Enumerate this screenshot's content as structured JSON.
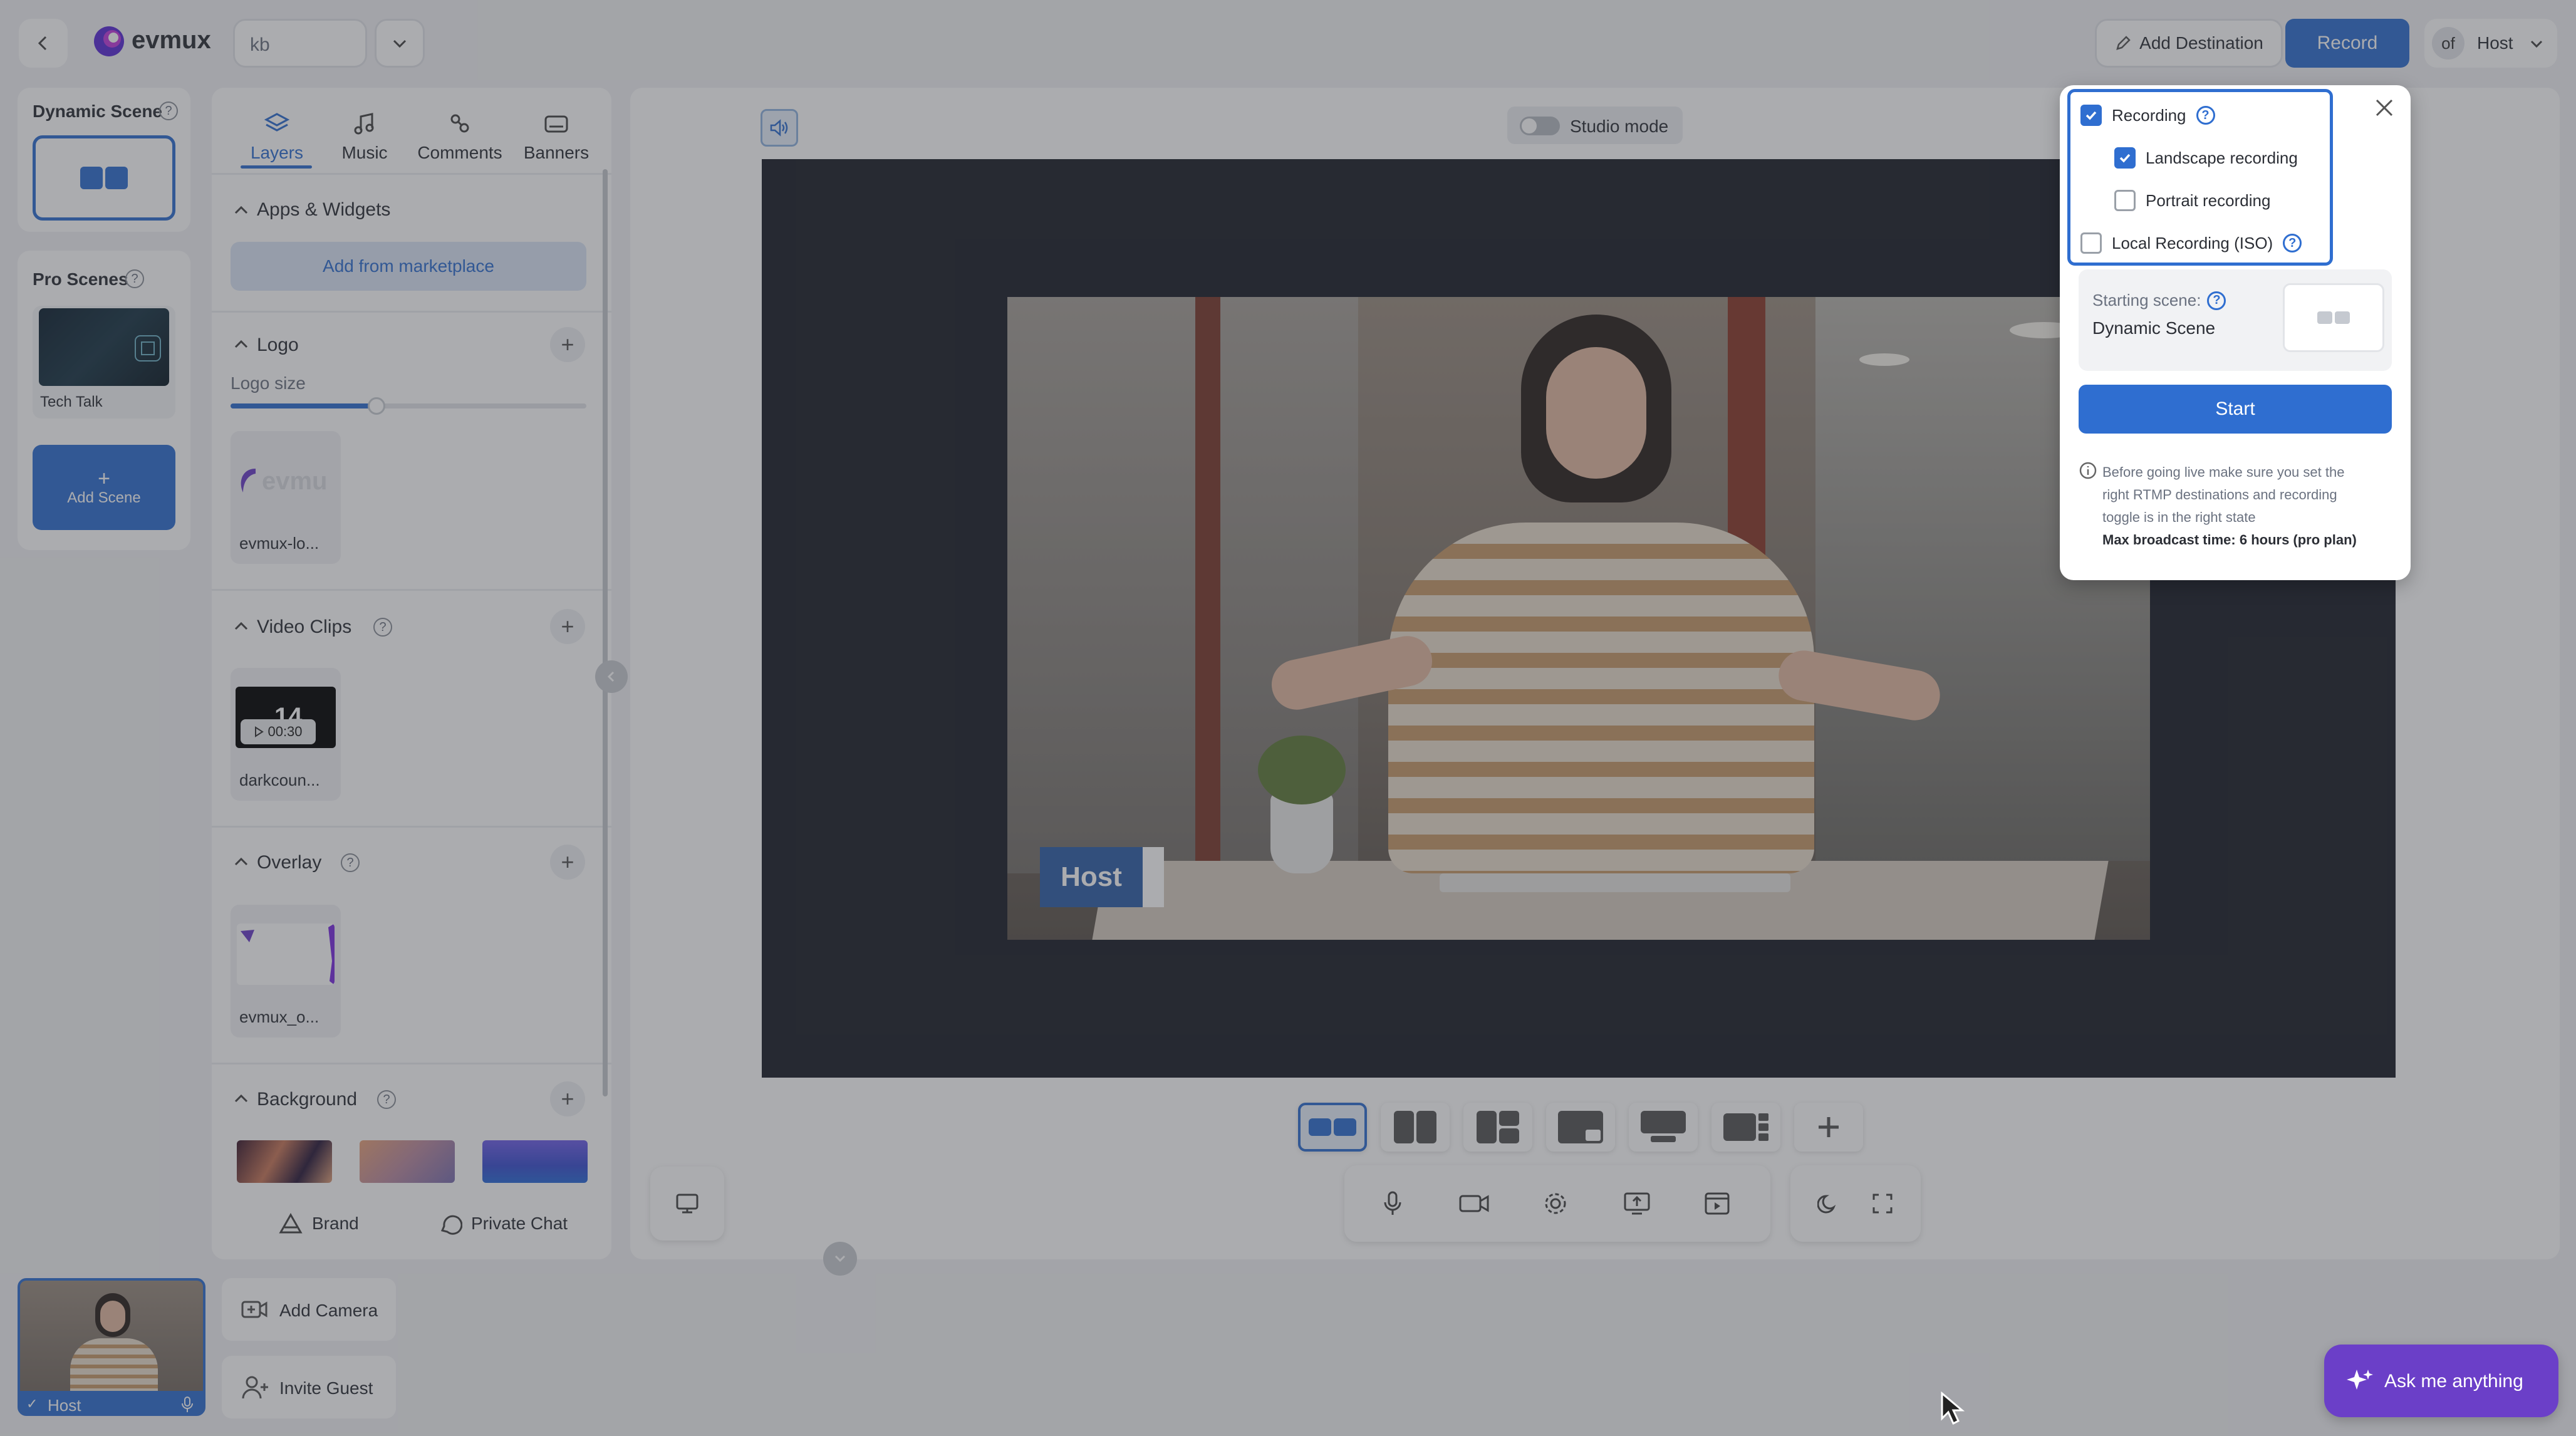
{
  "header": {
    "brand": "evmux",
    "studio_name": "kb",
    "add_destination_label": "Add Destination",
    "record_label": "Record",
    "user_initials": "of",
    "user_name": "Host"
  },
  "scenes": {
    "dynamic_title": "Dynamic Scene",
    "pro_title": "Pro Scenes",
    "pro_items": [
      {
        "label": "Tech Talk"
      }
    ],
    "add_scene_label": "Add Scene"
  },
  "layers_panel": {
    "tabs": [
      {
        "label": "Layers",
        "icon": "layers-icon"
      },
      {
        "label": "Music",
        "icon": "music-icon"
      },
      {
        "label": "Comments",
        "icon": "comments-icon"
      },
      {
        "label": "Banners",
        "icon": "banners-icon"
      }
    ],
    "apps_title": "Apps & Widgets",
    "add_marketplace_label": "Add from marketplace",
    "logo_title": "Logo",
    "logo_size_label": "Logo size",
    "logo_size_value": 0.41,
    "logo_item_label": "evmux-lo...",
    "logo_preview_text": "evmu",
    "video_clips_title": "Video Clips",
    "video_clip_label": "darkcoun...",
    "video_clip_duration": "00:30",
    "video_clip_overlay_text": "14",
    "overlay_title": "Overlay",
    "overlay_item_label": "evmux_o...",
    "background_title": "Background",
    "brand_label": "Brand",
    "private_chat_label": "Private Chat"
  },
  "stage": {
    "studio_mode_label": "Studio mode",
    "host_lower_third": "Host"
  },
  "bottom": {
    "participant_name": "Host",
    "add_camera_label": "Add Camera",
    "invite_guest_label": "Invite Guest",
    "ask_label": "Ask me anything"
  },
  "record_popup": {
    "recording_label": "Recording",
    "landscape_label": "Landscape recording",
    "portrait_label": "Portrait recording",
    "local_label": "Local Recording (ISO)",
    "recording_checked": true,
    "landscape_checked": true,
    "portrait_checked": false,
    "local_checked": false,
    "starting_scene_label": "Starting scene:",
    "starting_scene_value": "Dynamic Scene",
    "start_label": "Start",
    "info_line1": "Before going live make sure you set the",
    "info_line2": "right RTMP destinations and recording",
    "info_line3": "toggle is in the right state",
    "info_bold": "Max broadcast time: 6 hours (pro plan)"
  },
  "colors": {
    "accent": "#2f6ed0",
    "ask_purple": "#6b3fc8",
    "stage_bg": "#1b1e28"
  }
}
